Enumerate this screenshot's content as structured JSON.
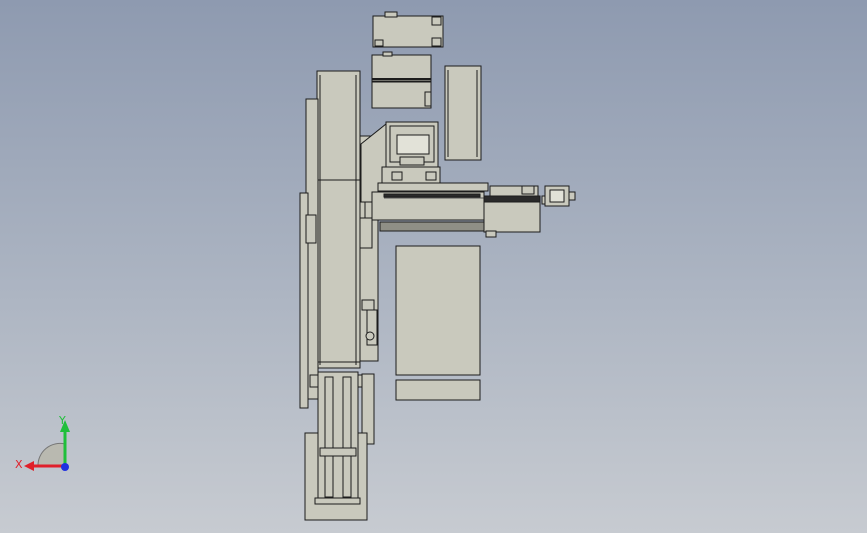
{
  "viewport": {
    "background_top": "#8e9ab0",
    "background_bottom": "#c7cbd1"
  },
  "model": {
    "fill_color": "#c9c9bd",
    "dark_fill_color": "#8f8f86",
    "edge_color": "#1c1c1c"
  },
  "triad": {
    "x_label": "X",
    "y_label": "Y",
    "x_color": "#e0202a",
    "y_color": "#1fbf3a",
    "z_color": "#2030e0"
  }
}
